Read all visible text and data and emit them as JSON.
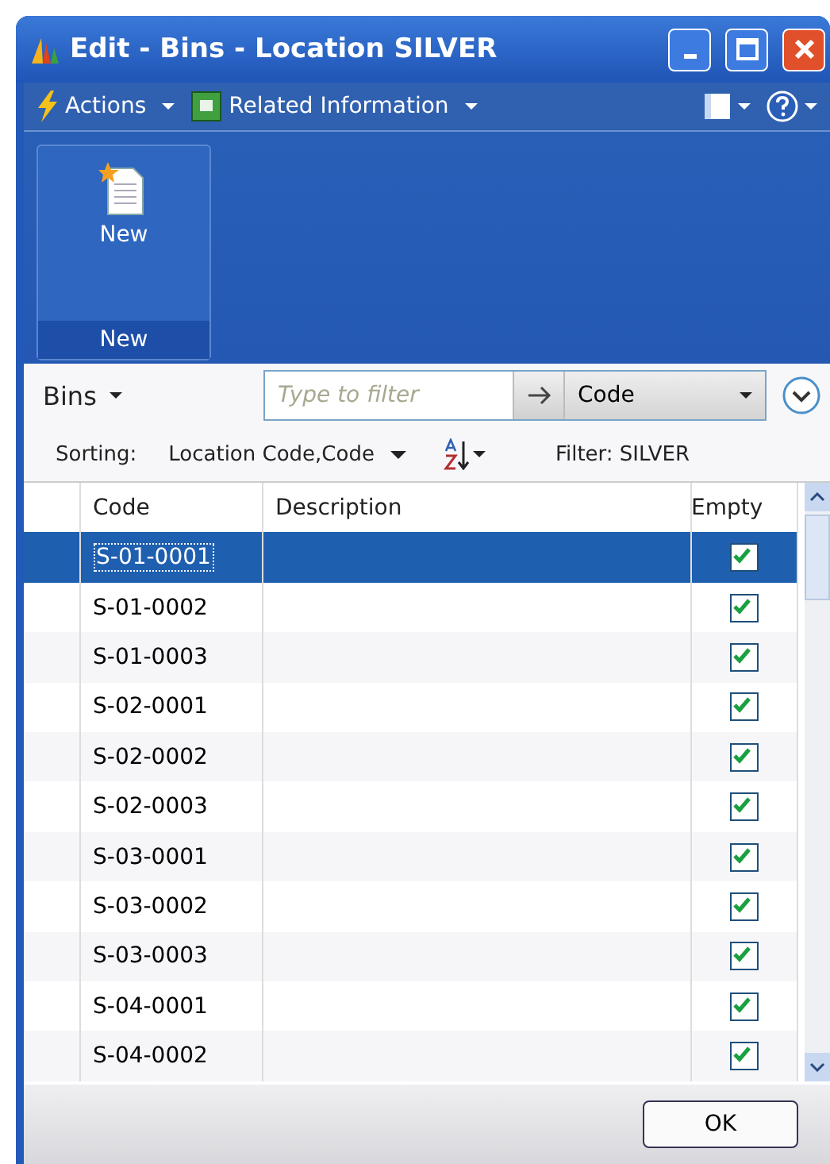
{
  "window": {
    "title": "Edit - Bins - Location SILVER"
  },
  "toolbar": [
    {
      "label": "Actions",
      "kind": "bolt"
    },
    {
      "label": "Related Information",
      "kind": "panel"
    }
  ],
  "ribbon": {
    "buttons": [
      {
        "label": "New"
      }
    ],
    "group": "New"
  },
  "list": {
    "title": "Bins",
    "filter_placeholder": "Type to filter",
    "filter_field": "Code",
    "sorting_label": "Sorting:",
    "sorting": "Location Code,Code",
    "filter": "Filter: SILVER"
  },
  "table": {
    "columns": [
      "Code",
      "Description",
      "Empty"
    ],
    "rows": [
      {
        "code": "S-01-0001",
        "empty": true,
        "selected": true
      },
      {
        "code": "S-01-0002",
        "empty": true,
        "selected": false
      },
      {
        "code": "S-01-0003",
        "empty": true,
        "selected": false
      },
      {
        "code": "S-02-0001",
        "empty": true,
        "selected": false
      },
      {
        "code": "S-02-0002",
        "empty": true,
        "selected": false
      },
      {
        "code": "S-02-0003",
        "empty": true,
        "selected": false
      },
      {
        "code": "S-03-0001",
        "empty": true,
        "selected": false
      },
      {
        "code": "S-03-0002",
        "empty": true,
        "selected": false
      },
      {
        "code": "S-03-0003",
        "empty": true,
        "selected": false
      },
      {
        "code": "S-04-0001",
        "empty": true,
        "selected": false
      },
      {
        "code": "S-04-0002",
        "empty": true,
        "selected": false
      }
    ]
  },
  "buttons": [
    "OK"
  ]
}
